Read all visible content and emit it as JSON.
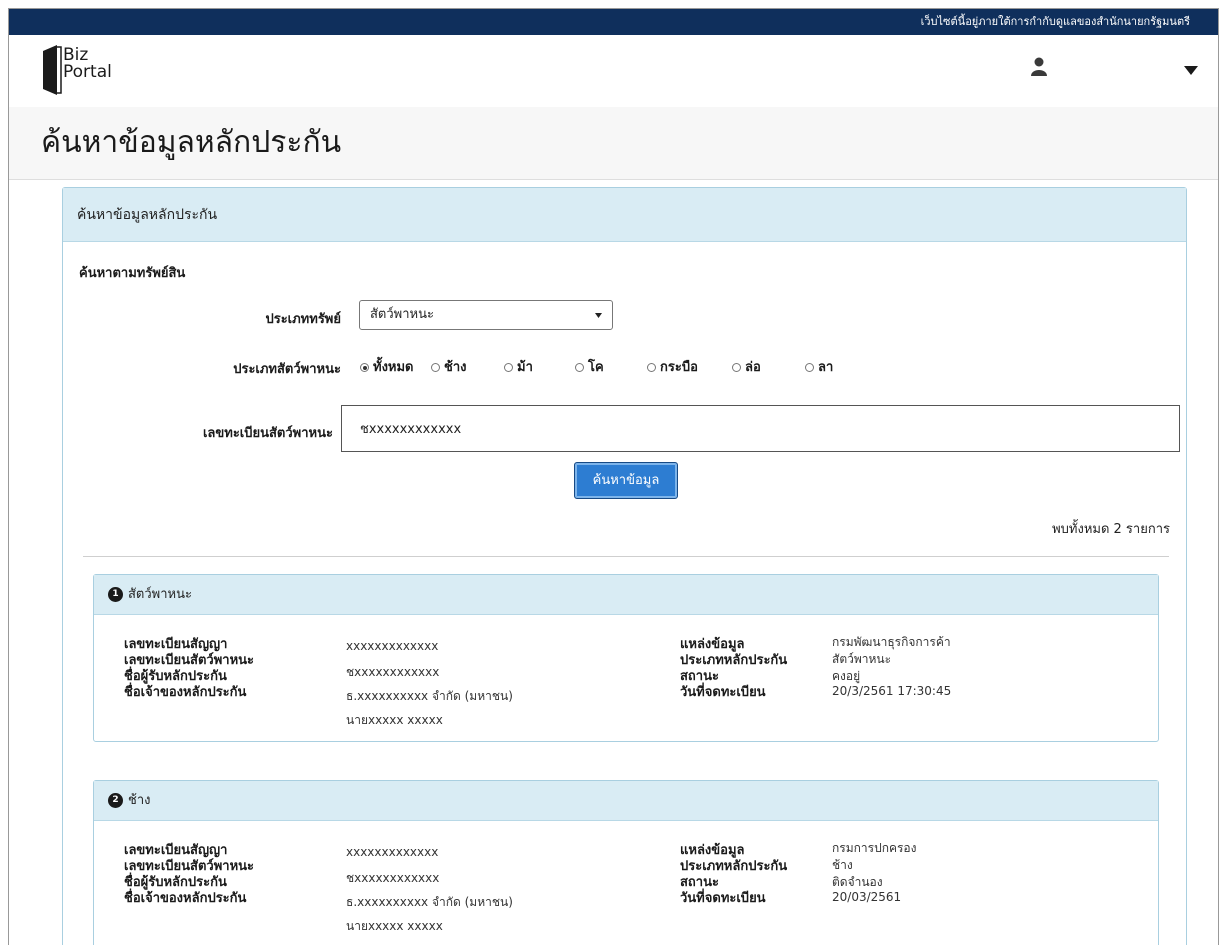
{
  "gov_banner": "เว็บไซต์นี้อยู่ภายใต้การกำกับดูแลของสำนักนายกรัฐมนตรี",
  "logo": {
    "line1": "Biz",
    "line2": "Portal"
  },
  "header": {
    "user_icon": "user-icon",
    "menu_icon": "caret-down-icon"
  },
  "page_title": "ค้นหาข้อมูลหลักประกัน",
  "panel": {
    "title": "ค้นหาข้อมูลหลักประกัน",
    "section_label": "ค้นหาตามทรัพย์สิน",
    "asset_type_label": "ประเภททรัพย์",
    "asset_type_value": "สัตว์พาหนะ",
    "animal_type_label": "ประเภทสัตว์พาหนะ",
    "animal_options": [
      "ทั้งหมด",
      "ช้าง",
      "ม้า",
      "โค",
      "กระบือ",
      "ล่อ",
      "ลา"
    ],
    "animal_selected": "ทั้งหมด",
    "reg_label": "เลขทะเบียนสัตว์พาหนะ",
    "reg_value": "ชxxxxxxxxxxxx",
    "search_button": "ค้นหาข้อมูล",
    "result_count": "พบทั้งหมด 2 รายการ"
  },
  "results": [
    {
      "number": "1",
      "title": "สัตว์พาหนะ",
      "labels_left": [
        "เลขทะเบียนสัญญา",
        "เลขทะเบียนสัตว์พาหนะ",
        "ชื่อผู้รับหลักประกัน",
        "ชื่อเจ้าของหลักประกัน"
      ],
      "values_left": [
        "xxxxxxxxxxxxx",
        "ชxxxxxxxxxxxx",
        "ธ.xxxxxxxxxx จำกัด (มหาชน)",
        "นายxxxxx xxxxx"
      ],
      "labels_right": [
        "แหล่งข้อมูล",
        "ประเภทหลักประกัน",
        "สถานะ",
        "วันที่จดทะเบียน"
      ],
      "values_right": [
        "กรมพัฒนาธุรกิจการค้า",
        "สัตว์พาหนะ",
        "คงอยู่",
        "20/3/2561 17:30:45"
      ]
    },
    {
      "number": "2",
      "title": "ช้าง",
      "labels_left": [
        "เลขทะเบียนสัญญา",
        "เลขทะเบียนสัตว์พาหนะ",
        "ชื่อผู้รับหลักประกัน",
        "ชื่อเจ้าของหลักประกัน"
      ],
      "values_left": [
        "xxxxxxxxxxxxx",
        "ชxxxxxxxxxxxx",
        "ธ.xxxxxxxxxx จำกัด (มหาชน)",
        "นายxxxxx xxxxx"
      ],
      "labels_right": [
        "แหล่งข้อมูล",
        "ประเภทหลักประกัน",
        "สถานะ",
        "วันที่จดทะเบียน"
      ],
      "values_right": [
        "กรมการปกครอง",
        "ช้าง",
        "ติดจำนอง",
        "20/03/2561"
      ]
    }
  ],
  "colors": {
    "gov_bar": "#0f2f5c",
    "panel_header": "#d9ecf4",
    "button": "#2d7dd2"
  }
}
